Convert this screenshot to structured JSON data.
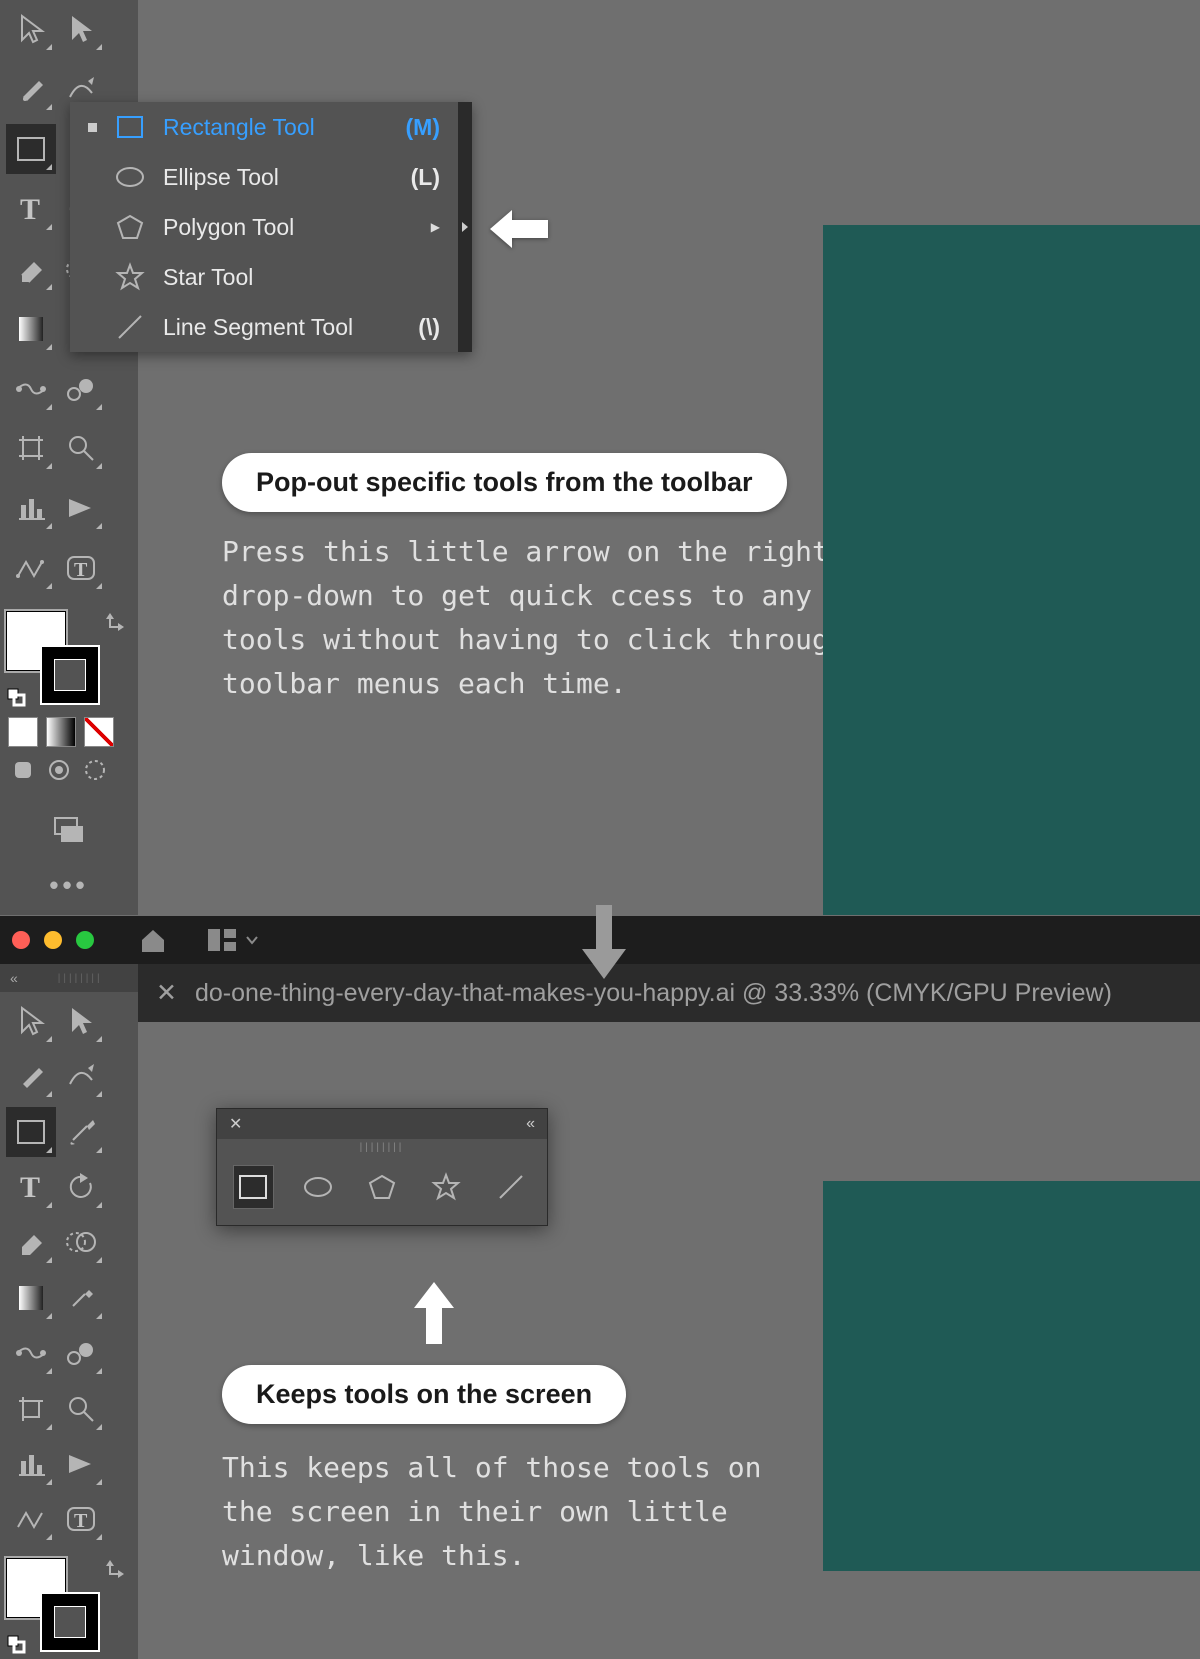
{
  "flyout": {
    "items": [
      {
        "label": "Rectangle Tool",
        "key": "(M)",
        "active": true,
        "hasSub": false
      },
      {
        "label": "Ellipse Tool",
        "key": "(L)",
        "active": false,
        "hasSub": false
      },
      {
        "label": "Polygon Tool",
        "key": "",
        "active": false,
        "hasSub": true
      },
      {
        "label": "Star Tool",
        "key": "",
        "active": false,
        "hasSub": false
      },
      {
        "label": "Line Segment Tool",
        "key": "(\\)",
        "active": false,
        "hasSub": false
      }
    ]
  },
  "annotations": {
    "bubble1": "Pop-out specific tools from the toolbar",
    "desc1": "Press this little arrow on the right of the\ndrop-down to get quick ccess to any panel of\ntools without having to click through the\ntoolbar menus each time.",
    "bubble2": "Keeps tools on the screen",
    "desc2": "This keeps all of those tools on\nthe screen in their own little\nwindow, like this."
  },
  "tab": {
    "title": "do-one-thing-every-day-that-makes-you-happy.ai @ 33.33% (CMYK/GPU Preview)"
  },
  "collapse": {
    "label": "«"
  },
  "more": {
    "label": "•••"
  },
  "panel": {
    "close": "✕",
    "collapse": "«"
  }
}
